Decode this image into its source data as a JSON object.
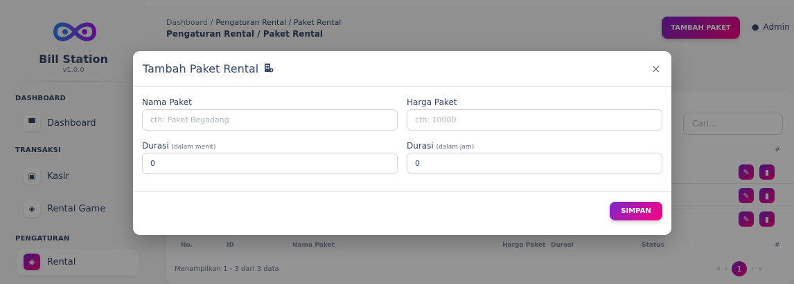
{
  "sidebar": {
    "brand": "Bill Station",
    "version": "v1.0.0",
    "sections": [
      {
        "label": "DASHBOARD"
      },
      {
        "label": "TRANSAKSI"
      },
      {
        "label": "PENGATURAN"
      }
    ],
    "items": [
      {
        "label": "Dashboard",
        "icon": "store-icon"
      },
      {
        "label": "Kasir",
        "icon": "cashier-icon"
      },
      {
        "label": "Rental Game",
        "icon": "gamepad-icon"
      },
      {
        "label": "Rental",
        "icon": "gamepad-icon",
        "active": true
      }
    ]
  },
  "header": {
    "breadcrumb": [
      "Dashboard",
      "Pengaturan Rental / Paket Rental"
    ],
    "title": "Pengaturan Rental / Paket Rental",
    "add_button": "TAMBAH PAKET",
    "user": "Admin"
  },
  "table": {
    "search_placeholder": "Cari...",
    "hash": "#",
    "columns": [
      "No.",
      "ID",
      "Nama Paket",
      "Harga Paket",
      "Durasi",
      "Status",
      "#"
    ],
    "showing": "Menampilkan 1 - 3 dari 3 data",
    "pager": {
      "first": "«",
      "prev": "‹",
      "current": "1",
      "next": "›",
      "last": "»"
    }
  },
  "modal": {
    "title": "Tambah Paket Rental",
    "close": "×",
    "fields": {
      "name_label": "Nama Paket",
      "name_placeholder": "cth: Paket Begadang",
      "price_label": "Harga Paket",
      "price_placeholder": "cth: 10000",
      "duration_min_label": "Durasi",
      "duration_min_hint": "(dalam menit)",
      "duration_min_value": "0",
      "duration_hour_label": "Durasi",
      "duration_hour_hint": "(dalam jam)",
      "duration_hour_value": "0"
    },
    "save_button": "SIMPAN"
  },
  "colors": {
    "accent_start": "#7928ca",
    "accent_end": "#ff0080",
    "text": "#344767"
  }
}
